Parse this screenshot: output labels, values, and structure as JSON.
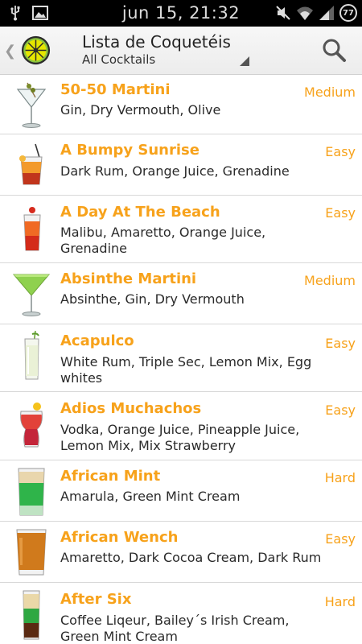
{
  "status_bar": {
    "time": "jun 15, 21:32",
    "battery": "77",
    "left_icons": [
      "usb-icon",
      "image-icon"
    ],
    "right_icons": [
      "mute-icon",
      "wifi-icon",
      "signal-icon",
      "battery-icon"
    ]
  },
  "action_bar": {
    "title": "Lista de Coquetéis",
    "subtitle": "All Cocktails",
    "logo_icon": "lime-logo-icon",
    "search_icon": "search-icon",
    "back_icon": "chevron-left-icon"
  },
  "colors": {
    "accent": "#f7a21b",
    "text": "#2a2a2a",
    "divider": "#d8d8d8"
  },
  "cocktails": [
    {
      "name": "50-50 Martini",
      "ingredients": "Gin, Dry Vermouth, Olive",
      "difficulty": "Medium",
      "icon": "martini-glass-icon"
    },
    {
      "name": "A Bumpy Sunrise",
      "ingredients": "Dark Rum, Orange Juice, Grenadine",
      "difficulty": "Easy",
      "icon": "rocks-glass-icon"
    },
    {
      "name": "A Day At The Beach",
      "ingredients": "Malibu, Amaretto, Orange Juice, Grenadine",
      "difficulty": "Easy",
      "icon": "highball-glass-icon"
    },
    {
      "name": "Absinthe Martini",
      "ingredients": "Absinthe, Gin, Dry Vermouth",
      "difficulty": "Medium",
      "icon": "martini-glass-icon"
    },
    {
      "name": "Acapulco",
      "ingredients": "White Rum, Triple Sec, Lemon Mix, Egg whites",
      "difficulty": "Easy",
      "icon": "collins-glass-icon"
    },
    {
      "name": "Adios Muchachos",
      "ingredients": "Vodka, Orange Juice, Pineapple Juice, Lemon Mix, Mix Strawberry",
      "difficulty": "Easy",
      "icon": "hurricane-glass-icon"
    },
    {
      "name": "African Mint",
      "ingredients": "Amarula, Green Mint Cream",
      "difficulty": "Hard",
      "icon": "layered-shot-icon"
    },
    {
      "name": "African Wench",
      "ingredients": "Amaretto, Dark Cocoa Cream, Dark Rum",
      "difficulty": "Easy",
      "icon": "shot-glass-icon"
    },
    {
      "name": "After Six",
      "ingredients": "Coffee Liqeur, Bailey´s Irish Cream, Green Mint Cream",
      "difficulty": "Hard",
      "icon": "layered-shooter-icon"
    }
  ]
}
